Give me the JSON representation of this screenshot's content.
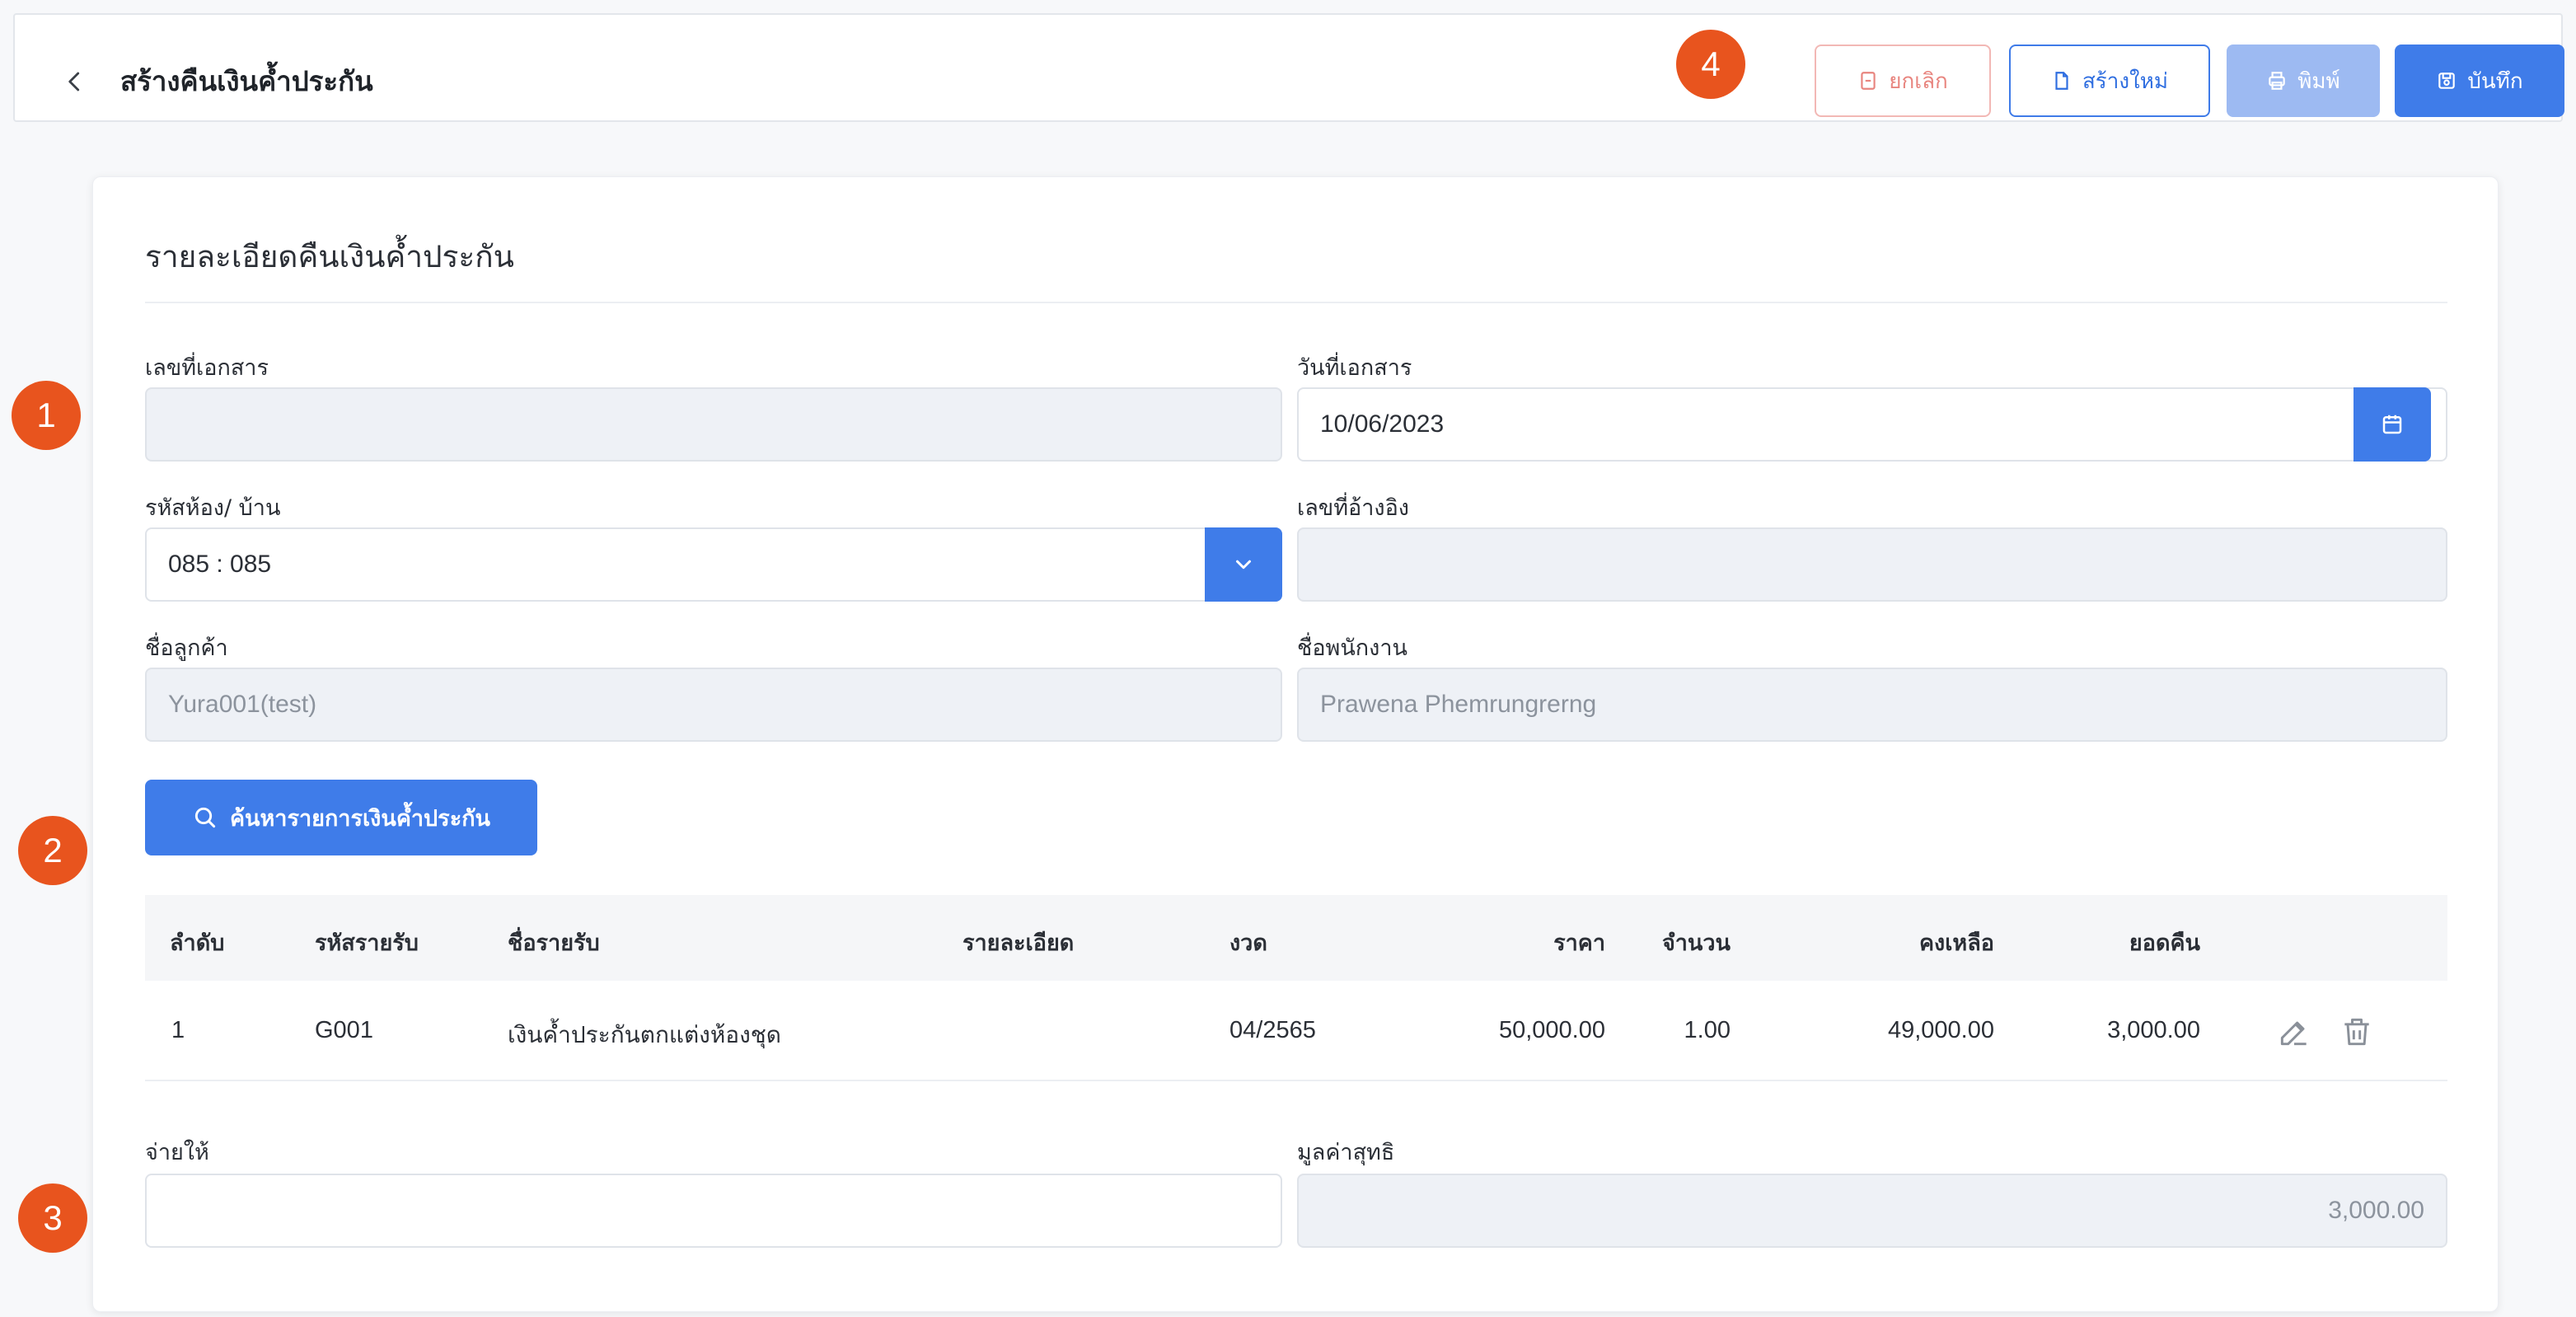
{
  "header": {
    "title": "สร้างคืนเงินค้ำประกัน",
    "buttons": {
      "cancel": "ยกเลิก",
      "new": "สร้างใหม่",
      "print": "พิมพ์",
      "save": "บันทึก"
    }
  },
  "annotations": {
    "step1": "1",
    "step2": "2",
    "step3": "3",
    "step4": "4"
  },
  "form": {
    "section_title": "รายละเอียดคืนเงินค้ำประกัน",
    "doc_no": {
      "label": "เลขที่เอกสาร",
      "value": ""
    },
    "doc_date": {
      "label": "วันที่เอกสาร",
      "value": "10/06/2023"
    },
    "room_code": {
      "label": "รหัสห้อง/ บ้าน",
      "value": "085 : 085"
    },
    "ref_no": {
      "label": "เลขที่อ้างอิง",
      "value": ""
    },
    "customer_name": {
      "label": "ชื่อลูกค้า",
      "value": "Yura001(test)"
    },
    "employee_name": {
      "label": "ชื่อพนักงาน",
      "value": "Prawena Phemrungrerng"
    },
    "search_button": "ค้นหารายการเงินค้ำประกัน",
    "pay_to": {
      "label": "จ่ายให้",
      "value": ""
    },
    "net_value": {
      "label": "มูลค่าสุทธิ",
      "value": "3,000.00"
    }
  },
  "table": {
    "columns": [
      "ลำดับ",
      "รหัสรายรับ",
      "ชื่อรายรับ",
      "รายละเอียด",
      "งวด",
      "ราคา",
      "จำนวน",
      "คงเหลือ",
      "ยอดคืน"
    ],
    "rows": [
      {
        "no": "1",
        "code": "G001",
        "name": "เงินค้ำประกันตกแต่งห้องชุด",
        "detail": "",
        "period": "04/2565",
        "price": "50,000.00",
        "qty": "1.00",
        "remaining": "49,000.00",
        "refund": "3,000.00"
      }
    ]
  },
  "colors": {
    "primary": "#3f7ce9",
    "badge": "#e8541e",
    "cancel_border": "#f2b8b5"
  }
}
